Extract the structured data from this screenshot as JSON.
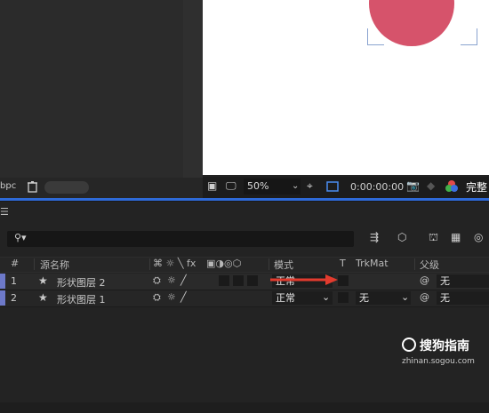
{
  "project_footer": {
    "bpc_label": "bpc"
  },
  "viewer": {
    "zoom": "50%",
    "timecode": "0:00:00:00",
    "resolution": "完整",
    "shape_color": "#d6536b"
  },
  "timeline": {
    "search_placeholder": "",
    "headers": {
      "hash": "#",
      "source_name": "源名称",
      "switches": "⌘ ☼ ╲ fx",
      "mode": "模式",
      "t": "T",
      "trkmat": "TrkMat",
      "parent": "父级"
    },
    "layers": [
      {
        "num": "1",
        "name": "形状图层 2",
        "mode": "",
        "trkmat": "",
        "parent": "无"
      },
      {
        "num": "2",
        "name": "形状图层 1",
        "mode": "正常",
        "trkmat": "无",
        "parent": "无"
      }
    ],
    "layer1_mode": "正常",
    "label_color": "#6d79c9"
  },
  "watermark": {
    "text": "搜狗指南",
    "url": "zhinan.sogou.com"
  },
  "icons": [
    "trash-icon",
    "snapshot-icon",
    "monitor-icon",
    "zoom-chevron-icon",
    "region-icon",
    "grid-icon",
    "camera-icon",
    "color-channel-icon",
    "menu-icon",
    "search-icon",
    "star-icon",
    "pickwhip-icon",
    "red-arrow"
  ]
}
